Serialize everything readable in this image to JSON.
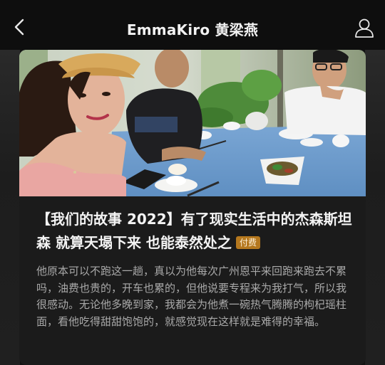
{
  "header": {
    "title": "EmmaKiro 黄梁燕",
    "back_icon": "chevron-left-icon",
    "profile_icon": "user-icon"
  },
  "article": {
    "headline": "【我们的故事 2022】有了现实生活中的杰森斯坦森 就算天塌下来 也能泰然处之",
    "paid_badge": "付费",
    "summary": "他原本可以不跑这一趟，真以为他每次广州恩平来回跑来跑去不累吗，油费也贵的，开车也累的，但他说要专程来为我打气，所以我很感动。无论他多晚到家，我都会为他煮一碗热气腾腾的枸杞瑶柱面，看他吃得甜甜饱饱的，就感觉现在这样就是难得的幸福。"
  },
  "colors": {
    "background": "#121212",
    "card": "#1b1b1b",
    "paid_badge": "#b5781e",
    "tablecloth": "#6e9ccc"
  }
}
